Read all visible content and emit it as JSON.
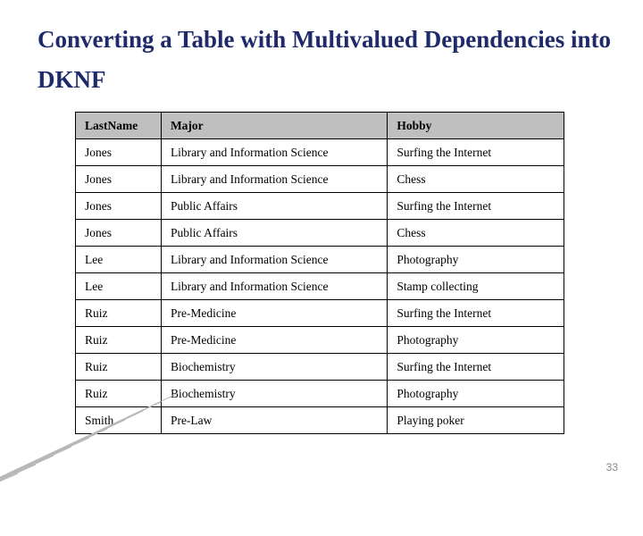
{
  "title": "Converting a Table with Multivalued Dependencies into DKNF",
  "table": {
    "headers": [
      "LastName",
      "Major",
      "Hobby"
    ],
    "rows": [
      [
        "Jones",
        "Library and Information Science",
        "Surfing the Internet"
      ],
      [
        "Jones",
        "Library and Information Science",
        "Chess"
      ],
      [
        "Jones",
        "Public Affairs",
        "Surfing the Internet"
      ],
      [
        "Jones",
        "Public Affairs",
        "Chess"
      ],
      [
        "Lee",
        "Library and Information Science",
        "Photography"
      ],
      [
        "Lee",
        "Library and Information Science",
        "Stamp collecting"
      ],
      [
        "Ruiz",
        "Pre-Medicine",
        "Surfing the Internet"
      ],
      [
        "Ruiz",
        "Pre-Medicine",
        "Photography"
      ],
      [
        "Ruiz",
        "Biochemistry",
        "Surfing the Internet"
      ],
      [
        "Ruiz",
        "Biochemistry",
        "Photography"
      ],
      [
        "Smith",
        "Pre-Law",
        "Playing poker"
      ]
    ]
  },
  "page_number": "33"
}
